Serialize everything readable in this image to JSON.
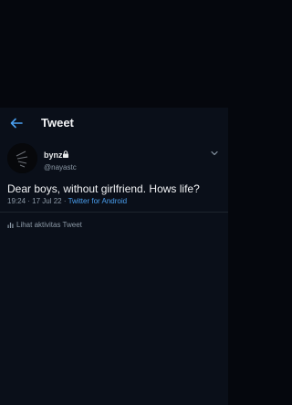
{
  "header": {
    "title": "Tweet",
    "back_icon": "arrow-left-icon"
  },
  "tweet": {
    "author_name": "bynz",
    "protected_icon": "lock-icon",
    "handle": "@nayastc",
    "text": "Dear boys, without girlfriend. Hows life?",
    "time": "19:24",
    "separator1": " · ",
    "date": "17 Jul 22",
    "separator2": " · ",
    "source": "Twitter for Android",
    "menu_icon": "chevron-down-icon"
  },
  "activity": {
    "label": "Lihat aktivitas Tweet",
    "icon": "bar-chart-icon"
  },
  "colors": {
    "background": "#05070d",
    "panel": "#0a0f19",
    "accent": "#4a9fef",
    "muted": "#8b98a5",
    "text": "#e7e9ea"
  }
}
